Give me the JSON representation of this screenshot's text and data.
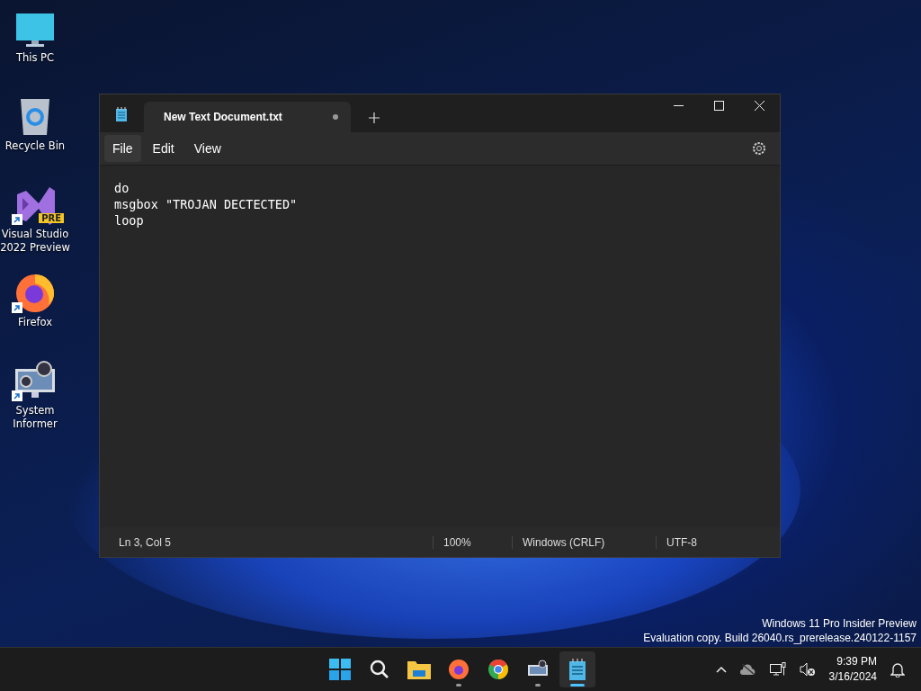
{
  "desktop_icons": [
    {
      "label": "This PC",
      "kind": "pc",
      "shortcut": false
    },
    {
      "label": "Recycle Bin",
      "kind": "bin",
      "shortcut": false
    },
    {
      "label": "Visual Studio 2022 Preview",
      "kind": "vs",
      "shortcut": true,
      "badge": "PRE"
    },
    {
      "label": "Firefox",
      "kind": "firefox",
      "shortcut": true
    },
    {
      "label": "System Informer",
      "kind": "sysinf",
      "shortcut": true
    }
  ],
  "window": {
    "tab_title": "New Text Document.txt",
    "unsaved": true,
    "menu": [
      {
        "label": "File",
        "selected": true
      },
      {
        "label": "Edit",
        "selected": false
      },
      {
        "label": "View",
        "selected": false
      }
    ],
    "lines": [
      "do",
      "msgbox \"TROJAN DECTECTED\"",
      "loop"
    ],
    "status_bar": [
      "Ln 3, Col 5",
      "100%",
      "Windows (CRLF)",
      "UTF-8"
    ]
  },
  "watermark": [
    "Windows 11 Pro Insider Preview",
    "Evaluation copy. Build 26040.rs_prerelease.240122-1157"
  ],
  "taskbar": {
    "apps": [
      {
        "kind": "start",
        "running": false,
        "active": false
      },
      {
        "kind": "search",
        "running": false,
        "active": false
      },
      {
        "kind": "folder",
        "running": false,
        "active": false
      },
      {
        "kind": "firefox",
        "running": true,
        "active": false
      },
      {
        "kind": "chrome",
        "running": false,
        "active": false
      },
      {
        "kind": "sysinf",
        "running": true,
        "active": false
      },
      {
        "kind": "notepad",
        "running": true,
        "active": true
      }
    ],
    "time": "9:39 PM",
    "date": "3/16/2024"
  }
}
